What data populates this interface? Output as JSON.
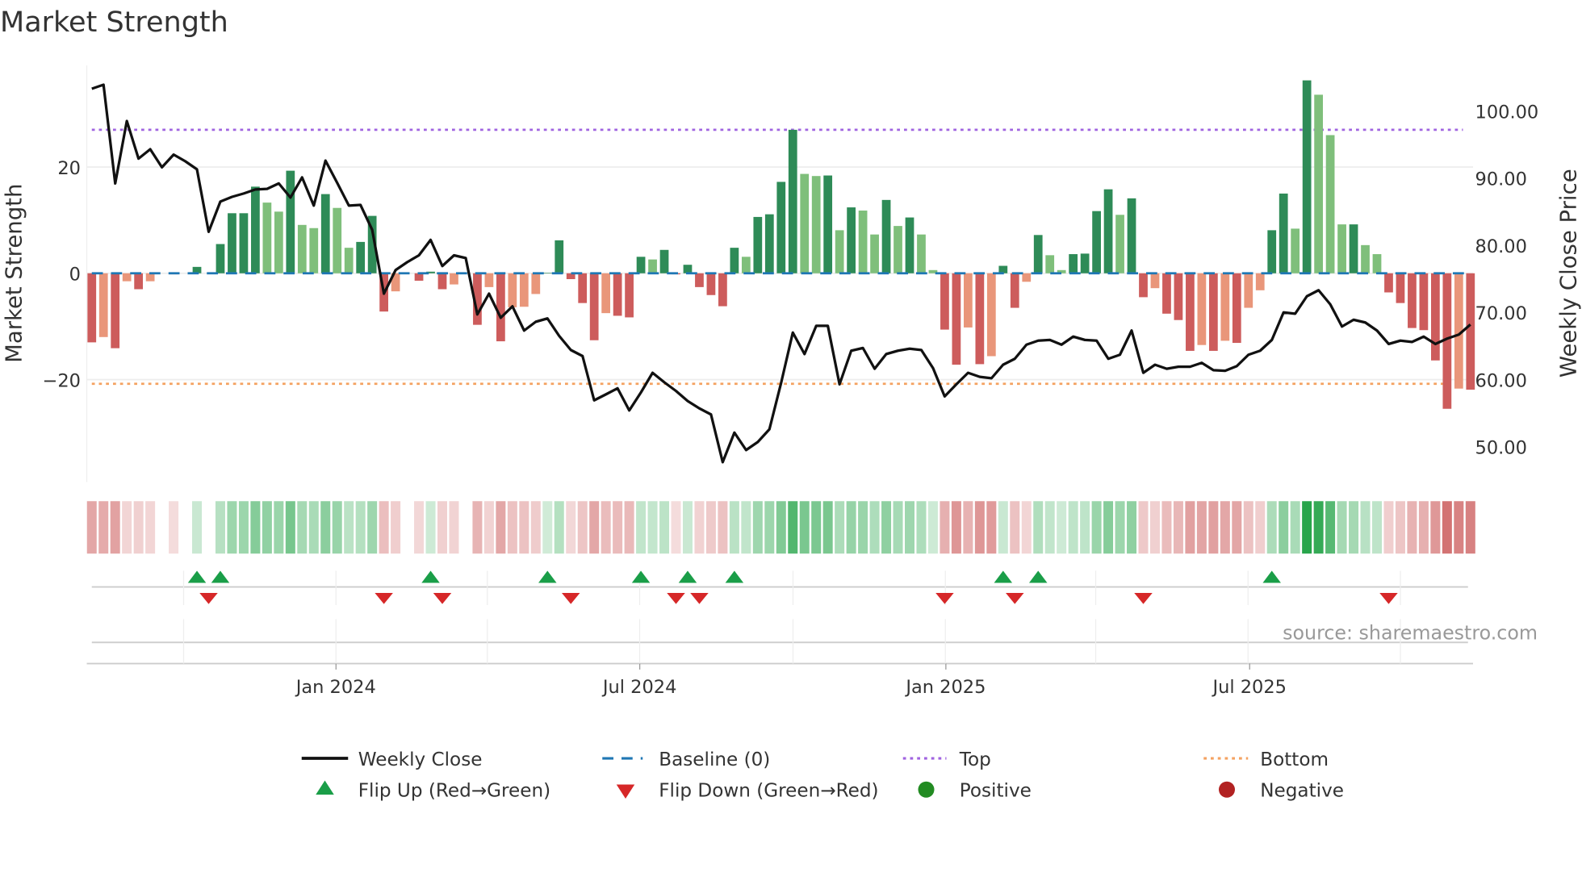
{
  "title": "Market Strength",
  "source": "source: sharemaestro.com",
  "colors": {
    "strong_green": "#2e8b57",
    "weak_green": "#7fbf7b",
    "strong_red": "#cd5c5c",
    "weak_red": "#e9967a",
    "baseline": "#1f77b4",
    "top": "#a064e0",
    "bottom": "#f4a261",
    "flip_up": "#1a9e48",
    "flip_down": "#d62728",
    "positive": "#228b22",
    "negative": "#b22222",
    "line": "#111111"
  },
  "chart_data": {
    "type": "bar+line",
    "title": "Market Strength",
    "ylabel": "Market Strength",
    "y2label": "Weekly Close Price",
    "ylim": [
      -39,
      39.5
    ],
    "y2lim": [
      45.3,
      107.1
    ],
    "yticks": [
      "20",
      "0",
      "−20"
    ],
    "yticks_values": [
      20,
      0,
      -20
    ],
    "y2ticks": [
      "100.00",
      "90.00",
      "80.00",
      "70.00",
      "60.00",
      "50.00"
    ],
    "y2ticks_values": [
      100,
      90,
      80,
      70,
      60,
      50
    ],
    "xticks": [
      "Jan 2024",
      "Jul 2024",
      "Jan 2025",
      "Jul 2025"
    ],
    "xticks_week_index": [
      20.9,
      46.9,
      73.1,
      99.1
    ],
    "top_level": 27,
    "bottom_level": -20.8,
    "baseline": 0,
    "strength": [
      -13,
      -12,
      -14.1,
      -1.5,
      -3,
      -1.5,
      0,
      -0.2,
      0,
      1.2,
      0,
      5.5,
      11.3,
      11.3,
      16.3,
      13.3,
      11.6,
      19.3,
      9.1,
      8.5,
      14.9,
      12.3,
      4.8,
      5.9,
      10.8,
      -7.2,
      -3.4,
      0,
      -1.4,
      0.3,
      -3,
      -2.1,
      0,
      -9.7,
      -2.6,
      -12.8,
      -6.4,
      -6.3,
      -3.9,
      0.1,
      6.2,
      -1.1,
      -5.6,
      -12.6,
      -7.5,
      -8,
      -8.3,
      3.1,
      2.6,
      4.4,
      -0.2,
      1.6,
      -2.6,
      -4.1,
      -6.2,
      4.8,
      3.1,
      10.6,
      11.1,
      17.2,
      27,
      18.7,
      18.3,
      18.4,
      8.1,
      12.4,
      11.8,
      7.3,
      13.8,
      8.9,
      10.5,
      7.3,
      0.6,
      -10.6,
      -17.2,
      -10.2,
      -17.1,
      -15.6,
      1.4,
      -6.5,
      -1.6,
      7.2,
      3.4,
      0.6,
      3.6,
      3.7,
      11.7,
      15.8,
      11,
      14.1,
      -4.5,
      -2.8,
      -7.6,
      -8.8,
      -14.6,
      -13.5,
      -14.6,
      -12.7,
      -13.1,
      -6.5,
      -3.2,
      8.1,
      15,
      8.4,
      36.3,
      33.6,
      26,
      9.2,
      9.2,
      5.3,
      3.6,
      -3.6,
      -5.6,
      -10.3,
      -10.7,
      -16.4,
      -25.5,
      -21.7,
      -21.9
    ],
    "weekly_close": [
      103.3,
      103.9,
      89.2,
      98.5,
      92.9,
      94.3,
      91.6,
      93.5,
      92.5,
      91.3,
      82,
      86.5,
      87.2,
      87.7,
      88.3,
      88.4,
      89.2,
      87.1,
      90.1,
      85.9,
      92.6,
      89.3,
      85.9,
      86,
      82.3,
      72.8,
      76.3,
      77.5,
      78.5,
      80.8,
      76.9,
      78.5,
      78.1,
      69.7,
      72.8,
      69.2,
      70.9,
      67.3,
      68.6,
      69.1,
      66.5,
      64.4,
      63.5,
      56.9,
      57.8,
      58.7,
      55.4,
      58.1,
      61,
      59.6,
      58.3,
      56.8,
      55.7,
      54.8,
      47.7,
      52.1,
      49.5,
      50.7,
      52.6,
      59.5,
      67,
      63.8,
      68,
      68,
      59.3,
      64.3,
      64.7,
      61.6,
      63.8,
      64.3,
      64.6,
      64.4,
      61.7,
      57.5,
      59.3,
      61,
      60.4,
      60.2,
      62.2,
      63.1,
      65.2,
      65.8,
      65.9,
      65.2,
      66.4,
      65.9,
      65.8,
      63.1,
      63.7,
      67.3,
      61,
      62.2,
      61.6,
      61.9,
      61.9,
      62.5,
      61.4,
      61.3,
      62,
      63.7,
      64.3,
      65.9,
      70,
      69.8,
      72.4,
      73.3,
      71.2,
      67.9,
      68.9,
      68.5,
      67.3,
      65.3,
      65.8,
      65.6,
      66.4,
      65.3,
      66.1,
      66.7,
      68.2
    ],
    "flip_up_weeks": [
      9,
      11,
      29,
      39,
      47,
      51,
      55,
      78,
      81,
      101
    ],
    "flip_down_weeks": [
      10,
      25,
      30,
      41,
      50,
      52,
      73,
      79,
      90,
      111
    ],
    "legend": {
      "position": "bottom",
      "items": [
        "Weekly Close",
        "Baseline (0)",
        "Top",
        "Bottom",
        "Flip Up (Red→Green)",
        "Flip Down (Green→Red)",
        "Positive",
        "Negative"
      ]
    }
  }
}
